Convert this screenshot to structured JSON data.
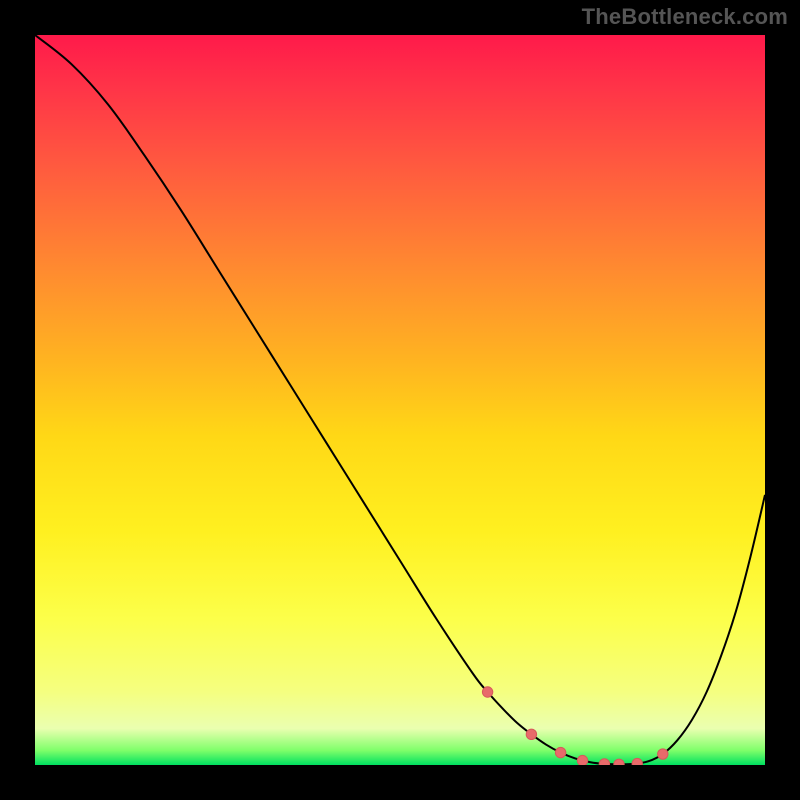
{
  "watermark": "TheBottleneck.com",
  "colors": {
    "background": "#000000",
    "curve": "#000000",
    "marker_fill": "#e86a6a",
    "marker_stroke": "#d65a5a"
  },
  "chart_data": {
    "type": "line",
    "title": "",
    "xlabel": "",
    "ylabel": "",
    "xlim": [
      0,
      100
    ],
    "ylim": [
      0,
      100
    ],
    "grid": false,
    "annotations": [
      "TheBottleneck.com"
    ],
    "x": [
      0,
      5,
      10,
      15,
      20,
      25,
      30,
      35,
      40,
      45,
      50,
      55,
      60,
      62,
      64,
      66,
      68,
      70,
      72,
      74,
      76,
      78,
      80,
      82,
      84,
      86,
      88,
      90,
      92,
      94,
      96,
      98,
      100
    ],
    "y": [
      100,
      96,
      90.5,
      83.5,
      76,
      68,
      60,
      52,
      44,
      36,
      28,
      20,
      12.5,
      10,
      7.8,
      5.8,
      4.2,
      2.8,
      1.7,
      0.9,
      0.4,
      0.15,
      0.1,
      0.15,
      0.5,
      1.5,
      3.4,
      6.2,
      10,
      15,
      21,
      28.5,
      37
    ],
    "markers": {
      "x": [
        62,
        68,
        72,
        75,
        78,
        80,
        82.5,
        86
      ],
      "y": [
        10,
        4.2,
        1.7,
        0.6,
        0.15,
        0.1,
        0.2,
        1.5
      ]
    }
  }
}
